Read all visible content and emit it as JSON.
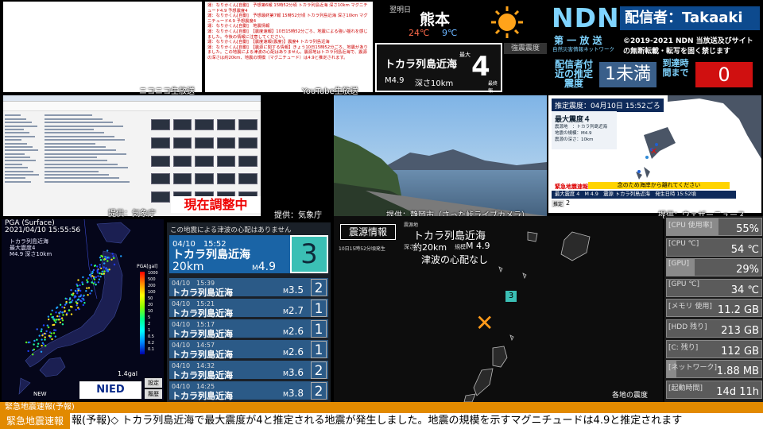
{
  "chat": {
    "label": "ニコニコ生放送",
    "lines": [
      "運：なりかくん[自動]　予想第6報 15時52分頃 トカラ列島近海 深さ10km マグニチュード4.9 予想震度4",
      "運：なりかくん[自動]　予想最終第7報 15時52分頃 トカラ列島近海 深さ10km マグニチュード4.9 予想震度4",
      "運：なりかくん[自動]　地震情報",
      "運：なりかくん[自動]　【震度速報】10日15時52分ごろ、地震による強い揺れを感じました。今後の情報に注意してください。",
      "運：なりかくん[自動]　【震度速報(震度)】震度4 トカラ列島近海",
      "運：なりかくん[自動]　【震源に関する情報】きょう10日15時52分ごろ、地震がありました。この地震による津波の心配はありません。震源地はトカラ列島近海で、震源の深さは約20km、地震の規模（マグニチュード）は4.9と推定されます。"
    ]
  },
  "youtube_label": "YouTube生放送",
  "explorer": {
    "status": "現在調整中",
    "credit": "提供：気象庁"
  },
  "weather": {
    "tomorrow": "翌明日",
    "city": "熊本",
    "high": "24℃",
    "low": "9℃"
  },
  "quake_card": {
    "place": "トカラ列島近海",
    "max_label": "最大",
    "final_label": "最終報",
    "intensity": "4",
    "magnitude": "M4.9",
    "depth": "深さ10km",
    "intensity_header": "強震震度"
  },
  "ndn": {
    "title": "NDN",
    "broadcaster": "配信者：Takaaki",
    "sub1": "第 一 放 送",
    "sub2": "自然災害情報ネットワーク",
    "copyright": "©2019-2021 NDN 当放送及びサイトの無断転載・転写を固く禁じます",
    "est_label": "配信者付近の推定震度",
    "est_value": "1未満",
    "arrival_label": "到達時間まで",
    "arrival_value": "0"
  },
  "camera": {
    "credit": "提供：静岡市（さった峠ライブカメラ）",
    "credit2": "提供：気象庁"
  },
  "eew": {
    "header": "推定震度：04月10日 15:52ごろ",
    "max": "最大震度４",
    "place": "震源地　：トカラ列島近海",
    "mag": "地震の規模：M4.9",
    "depth": "震源の深さ：10km",
    "bar_title": "緊急地震速報",
    "bar_msg": "念のため海岸から離れてください",
    "bar_line": "最大震度 4　M 4.9　震源 トカラ列島近海　発生日時 15:52頃",
    "bar_tag": "推定",
    "bar_num": "2",
    "credit": "提供：ウェザーニュース"
  },
  "nied": {
    "title": "PGA (Surface)",
    "time": "2021/04/10 15:55:56",
    "annot1": "トカラ列島近海",
    "annot2": "最大震度4",
    "annot3": "M4.9 深さ10km",
    "scale_title": "PGA[gal]",
    "scale": [
      "1000",
      "500",
      "200",
      "100",
      "50",
      "20",
      "10",
      "5",
      "2",
      "1",
      "0.5",
      "0.2",
      "0.1"
    ],
    "gal": "1.4gal",
    "new_label": "NEW",
    "logo": "NIED",
    "btn_settings": "設定",
    "btn_history": "履歴"
  },
  "quakes": {
    "header": "この地震による津波の心配はありません",
    "main": {
      "date": "04/10　15:52",
      "place": "トカラ列島近海",
      "depth": "20km",
      "mag": "4.9",
      "intensity": "3"
    },
    "rows": [
      {
        "date": "04/10　15:39",
        "place": "トカラ列島近海",
        "mag": "3.5",
        "intensity": "2"
      },
      {
        "date": "04/10　15:21",
        "place": "トカラ列島近海",
        "mag": "2.7",
        "intensity": "1"
      },
      {
        "date": "04/10　15:17",
        "place": "トカラ列島近海",
        "mag": "2.6",
        "intensity": "1"
      },
      {
        "date": "04/10　14:57",
        "place": "トカラ列島近海",
        "mag": "2.6",
        "intensity": "1"
      },
      {
        "date": "04/10　14:32",
        "place": "トカラ列島近海",
        "mag": "3.6",
        "intensity": "2"
      },
      {
        "date": "04/10　14:25",
        "place": "トカラ列島近海",
        "mag": "3.8",
        "intensity": "2"
      }
    ]
  },
  "epicenter": {
    "title": "震源情報",
    "time": "10日15時52分頃発生",
    "src_label": "震源地",
    "place": "トカラ列島近海",
    "depth_label": "深さ",
    "depth": "約20km",
    "scale_label": "規模",
    "mag": "M 4.9",
    "tsunami": "津波の心配なし",
    "marker": "3",
    "footer": "各地の震度"
  },
  "stats": [
    {
      "key": "[CPU 使用率]",
      "value": "55%",
      "fill": 0.55
    },
    {
      "key": "[CPU ℃]",
      "value": "54 ℃",
      "fill": 0
    },
    {
      "key": "[GPU]",
      "value": "29%",
      "fill": 0.29
    },
    {
      "key": "[GPU ℃]",
      "value": "34 ℃",
      "fill": 0
    },
    {
      "key": "[メモリ 使用]",
      "value": "11.2 GB",
      "fill": 0
    },
    {
      "key": "[HDD 残り]",
      "value": "213 GB",
      "fill": 0
    },
    {
      "key": "[C: 残り]",
      "value": "112 GB",
      "fill": 0
    },
    {
      "key": "[ネットワーク]",
      "value": "1.88 MB",
      "fill": 0.1
    },
    {
      "key": "[起動時間]",
      "value": "14d 11h",
      "fill": 0
    }
  ],
  "ticker": {
    "top": "緊急地震速報(予報)",
    "label": "緊急地震速報",
    "text": "報(予報)◇ トカラ列島近海で最大震度が4と推定される地震が発生しました。地震の規模を示すマグニチュードは4.9と推定されます"
  }
}
